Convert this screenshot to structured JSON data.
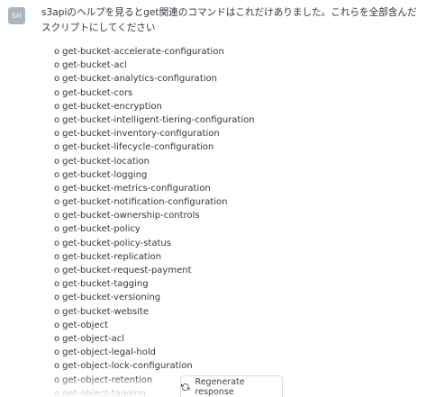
{
  "user": {
    "avatar_initials": "SH",
    "message": "s3apiのヘルプを見るとget関連のコマンドはこれだけありました。これらを全部含んだスクリプトにしてください"
  },
  "bullet": "o",
  "commands": [
    "get-bucket-accelerate-configuration",
    "get-bucket-acl",
    "get-bucket-analytics-configuration",
    "get-bucket-cors",
    "get-bucket-encryption",
    "get-bucket-intelligent-tiering-configuration",
    "get-bucket-inventory-configuration",
    "get-bucket-lifecycle-configuration",
    "get-bucket-location",
    "get-bucket-logging",
    "get-bucket-metrics-configuration",
    "get-bucket-notification-configuration",
    "get-bucket-ownership-controls",
    "get-bucket-policy",
    "get-bucket-policy-status",
    "get-bucket-replication",
    "get-bucket-request-payment",
    "get-bucket-tagging",
    "get-bucket-versioning",
    "get-bucket-website",
    "get-object",
    "get-object-acl",
    "get-object-legal-hold",
    "get-object-lock-configuration",
    "get-object-retention",
    "get-object-tagging"
  ],
  "regenerate": {
    "label": "Regenerate response",
    "icon": "refresh-icon"
  },
  "colors": {
    "avatar_bg": "#abb5bd",
    "text": "#343541",
    "button_border": "#d9d9e3"
  }
}
